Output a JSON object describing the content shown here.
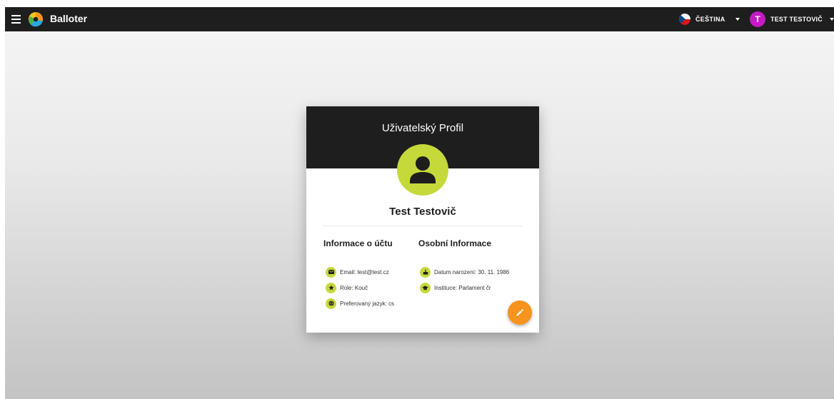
{
  "appbar": {
    "title": "Balloter",
    "menu_icon": "menu-icon",
    "logo_icon": "balloter-logo",
    "language": {
      "label": "ČEŠTINA",
      "flag": "czech-flag-icon"
    },
    "user": {
      "initial": "T",
      "name": "TEST TESTOVIČ",
      "avatar_color": "#c21bc4"
    }
  },
  "profile": {
    "title": "Uživatelský Profil",
    "name": "Test Testovič",
    "avatar_icon": "person-icon",
    "account_section": {
      "title": "Informace o účtu",
      "items": [
        {
          "icon": "email-icon",
          "text": "Email: test@test.cz"
        },
        {
          "icon": "star-icon",
          "text": "Role: Kouč"
        },
        {
          "icon": "globe-icon",
          "text": "Preferovaný jazyk: cs"
        }
      ]
    },
    "personal_section": {
      "title": "Osobní Informace",
      "items": [
        {
          "icon": "cake-icon",
          "text": "Datum narození: 30. 11. 1986"
        },
        {
          "icon": "school-icon",
          "text": "Instituce: Parlament čr"
        }
      ]
    },
    "edit_icon": "pencil-icon"
  },
  "colors": {
    "appbar_bg": "#1e1e1e",
    "accent_lime": "#c6d93a",
    "fab_orange": "#f7941d",
    "user_avatar": "#c21bc4"
  }
}
